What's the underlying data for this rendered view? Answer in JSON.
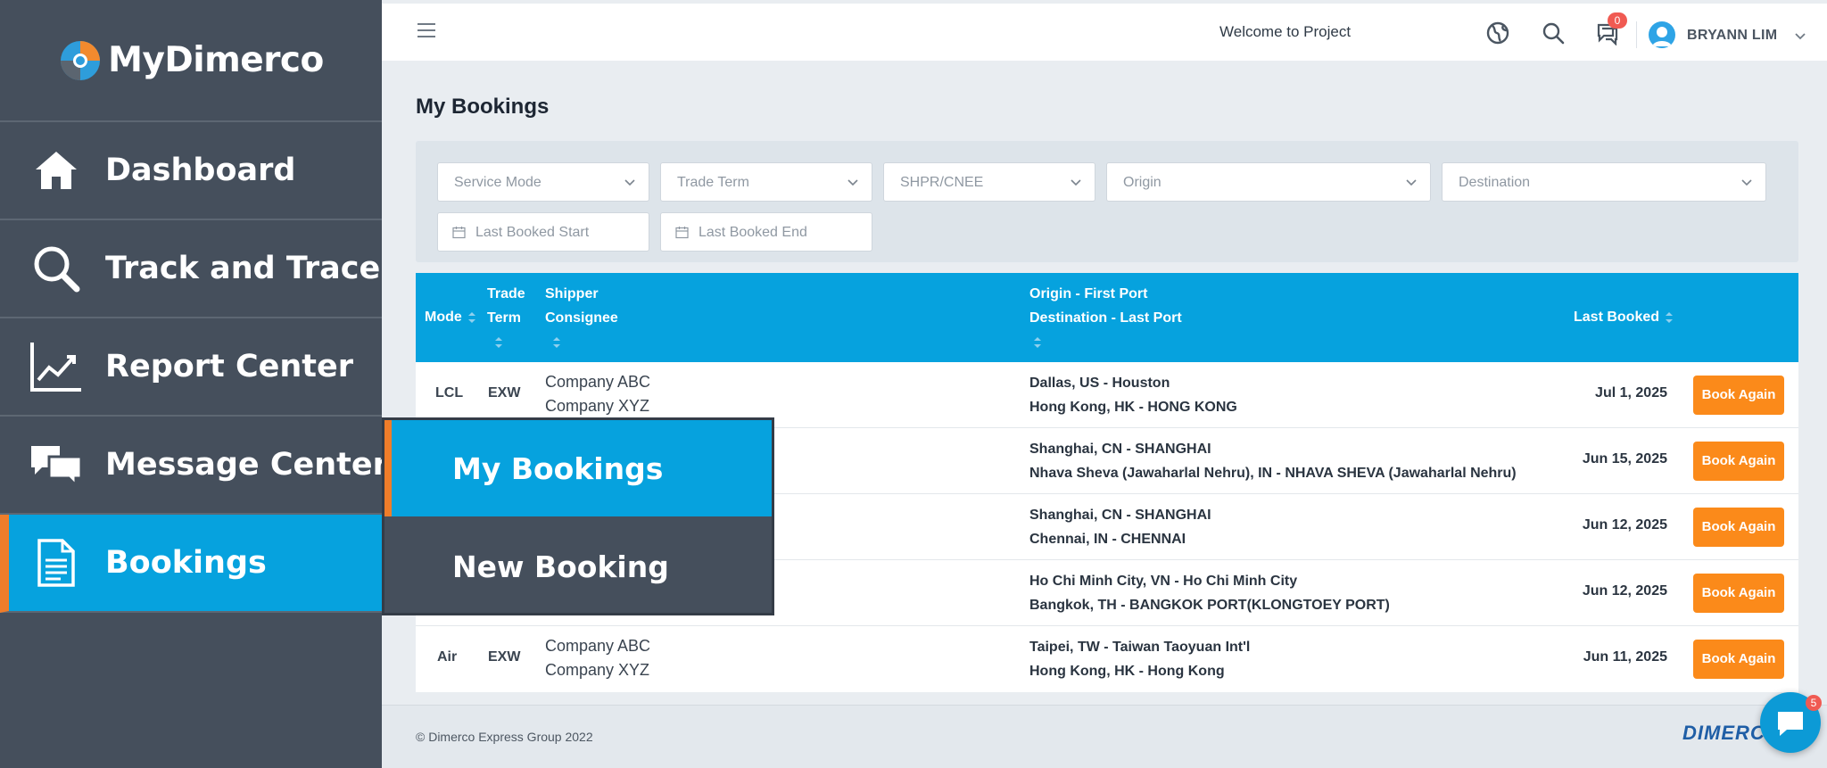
{
  "brand": {
    "name": "MyDimerco"
  },
  "sidebar": {
    "items": [
      {
        "label": "Dashboard",
        "icon": "home-icon"
      },
      {
        "label": "Track and Trace",
        "icon": "search-icon"
      },
      {
        "label": "Report Center",
        "icon": "chart-icon"
      },
      {
        "label": "Message Center",
        "icon": "chat-icon"
      },
      {
        "label": "Bookings",
        "icon": "document-icon",
        "active": true
      }
    ],
    "submenu": [
      {
        "label": "My Bookings",
        "active": true
      },
      {
        "label": "New Booking"
      }
    ]
  },
  "topbar": {
    "welcome": "Welcome to Project",
    "notification_count": "0",
    "user_name": "BRYANN LIM"
  },
  "page": {
    "title": "My Bookings"
  },
  "filters": {
    "service_mode": "Service Mode",
    "trade_term": "Trade Term",
    "shpr_cnee": "SHPR/CNEE",
    "origin": "Origin",
    "destination": "Destination",
    "last_booked_start": "Last Booked Start",
    "last_booked_end": "Last Booked End"
  },
  "table": {
    "headers": {
      "mode": "Mode",
      "trade": "Trade",
      "term": "Term",
      "shipper": "Shipper",
      "consignee": "Consignee",
      "origin": "Origin - First Port",
      "destination": "Destination - Last Port",
      "last_booked": "Last Booked"
    },
    "action_label": "Book Again",
    "rows": [
      {
        "mode": "LCL",
        "term": "EXW",
        "shipper": "Company ABC",
        "consignee": "Company XYZ",
        "origin": "Dallas, US - Houston",
        "destination": "Hong Kong, HK - HONG KONG",
        "date": "Jul 1, 2025"
      },
      {
        "mode": "",
        "term": "",
        "shipper": "",
        "consignee": "",
        "origin": "Shanghai, CN - SHANGHAI",
        "destination": "Nhava Sheva (Jawaharlal Nehru), IN - NHAVA SHEVA (Jawaharlal Nehru)",
        "date": "Jun 15, 2025"
      },
      {
        "mode": "",
        "term": "",
        "shipper": "",
        "consignee": "",
        "origin": "Shanghai, CN - SHANGHAI",
        "destination": "Chennai, IN - CHENNAI",
        "date": "Jun 12, 2025"
      },
      {
        "mode": "",
        "term": "",
        "shipper": "",
        "consignee": "",
        "origin": "Ho Chi Minh City, VN - Ho Chi Minh City",
        "destination": "Bangkok, TH - BANGKOK PORT(KLONGTOEY PORT)",
        "date": "Jun 12, 2025"
      },
      {
        "mode": "Air",
        "term": "EXW",
        "shipper": "Company ABC",
        "consignee": "Company XYZ",
        "origin": "Taipei, TW - Taiwan Taoyuan Int'l",
        "destination": "Hong Kong, HK - Hong Kong",
        "date": "Jun 11, 2025"
      }
    ]
  },
  "footer": {
    "copyright": "© Dimerco Express Group 2022",
    "logo_text": "DIMERCO",
    "chat_badge": "5"
  },
  "colors": {
    "sidebar_bg": "#454f5c",
    "accent_blue": "#06a2de",
    "accent_orange": "#ef7d2a",
    "button_orange": "#fb8a1a"
  }
}
